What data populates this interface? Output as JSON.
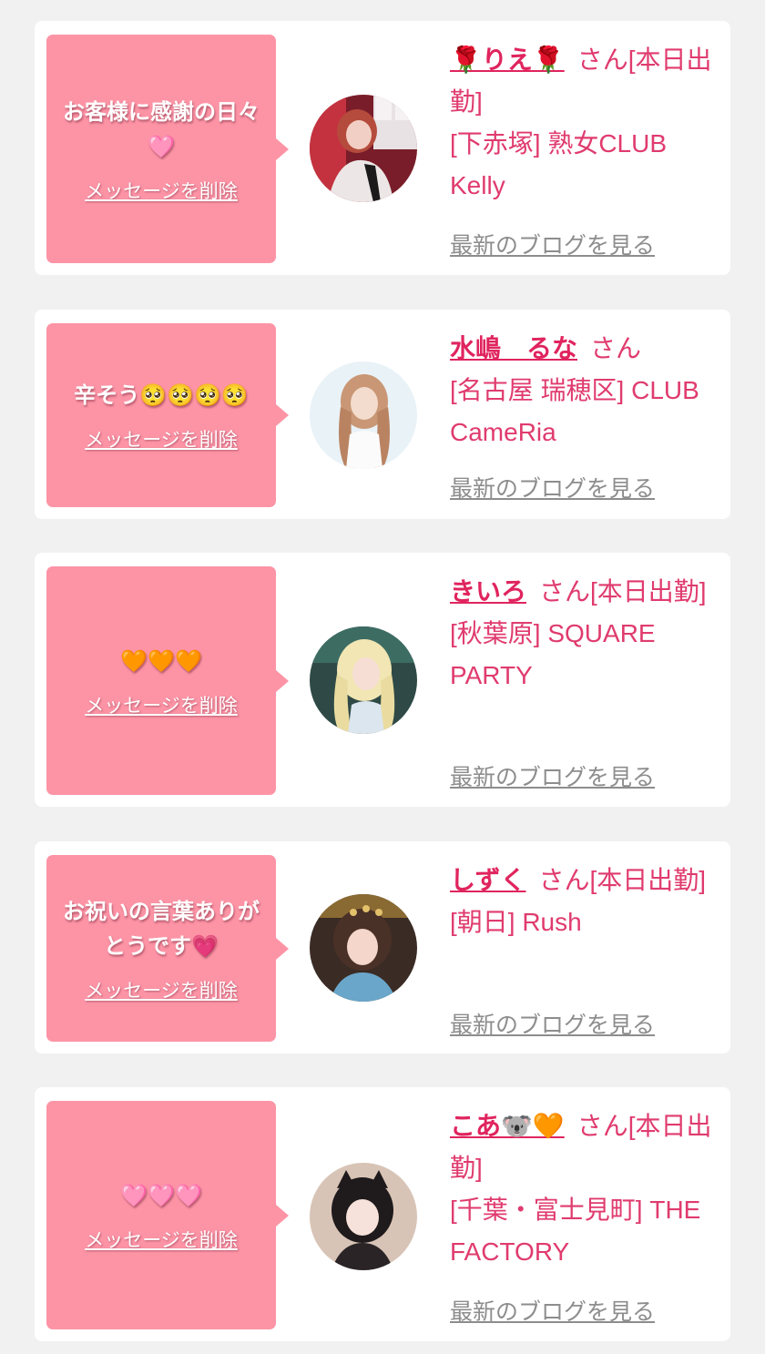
{
  "cards": [
    {
      "message": "お客様に感謝の日々🩷",
      "delete_label": "メッセージを削除",
      "name": "🌹りえ🌹",
      "honorific": "さん[本日出勤]",
      "shop": "[下赤塚] 熟女CLUB Kelly",
      "blog_label": "最新のブログを見る"
    },
    {
      "message": "辛そう🥺🥺🥺🥺",
      "delete_label": "メッセージを削除",
      "name": "水嶋　るな",
      "honorific": "さん",
      "shop": "[名古屋 瑞穂区] CLUB CameRia",
      "blog_label": "最新のブログを見る"
    },
    {
      "message": "🧡🧡🧡",
      "delete_label": "メッセージを削除",
      "name": "きいろ",
      "honorific": "さん[本日出勤]",
      "shop": "[秋葉原] SQUARE PARTY",
      "blog_label": "最新のブログを見る"
    },
    {
      "message": "お祝いの言葉ありがとうです💗",
      "delete_label": "メッセージを削除",
      "name": "しずく",
      "honorific": "さん[本日出勤]",
      "shop": "[朝日] Rush",
      "blog_label": "最新のブログを見る"
    },
    {
      "message": "🩷🩷🩷",
      "delete_label": "メッセージを削除",
      "name": "こあ🐨🧡",
      "honorific": "さん[本日出勤]",
      "shop": "[千葉・富士見町] THE FACTORY",
      "blog_label": "最新のブログを見る"
    }
  ],
  "colors": {
    "bubble": "#fd94a6",
    "name": "#e0245e",
    "text": "#e03b6e",
    "link": "#8d8d8d",
    "background": "#f1f1f1"
  }
}
